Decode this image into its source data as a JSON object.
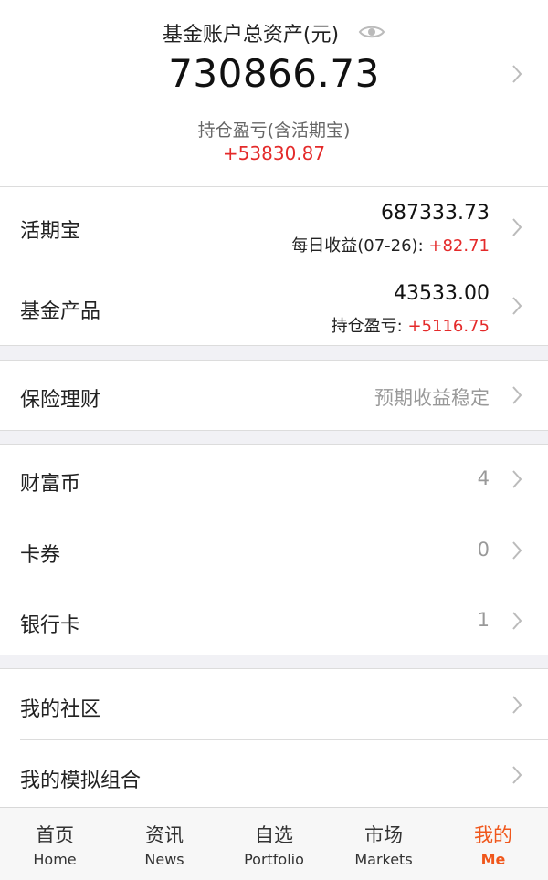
{
  "summary": {
    "title": "基金账户总资产(元)",
    "total": "730866.73",
    "pl_label": "持仓盈亏(含活期宝)",
    "pl_value": "+53830.87"
  },
  "accounts": {
    "huoqibao": {
      "label": "活期宝",
      "amount": "687333.73",
      "sub_label": "每日收益(07-26):",
      "sub_value": "+82.71"
    },
    "fund_products": {
      "label": "基金产品",
      "amount": "43533.00",
      "sub_label": "持仓盈亏:",
      "sub_value": "+5116.75"
    }
  },
  "insurance": {
    "label": "保险理财",
    "hint": "预期收益稳定"
  },
  "assets": [
    {
      "label": "财富币",
      "value": "4"
    },
    {
      "label": "卡券",
      "value": "0"
    },
    {
      "label": "银行卡",
      "value": "1"
    }
  ],
  "community": [
    {
      "label": "我的社区"
    },
    {
      "label": "我的模拟组合"
    }
  ],
  "nav": [
    {
      "cn": "首页",
      "en": "Home"
    },
    {
      "cn": "资讯",
      "en": "News"
    },
    {
      "cn": "自选",
      "en": "Portfolio"
    },
    {
      "cn": "市场",
      "en": "Markets"
    },
    {
      "cn": "我的",
      "en": "Me"
    }
  ],
  "colors": {
    "positive": "#e42a2a",
    "accent": "#f0571c",
    "section_gap": "#f1f1f5"
  }
}
